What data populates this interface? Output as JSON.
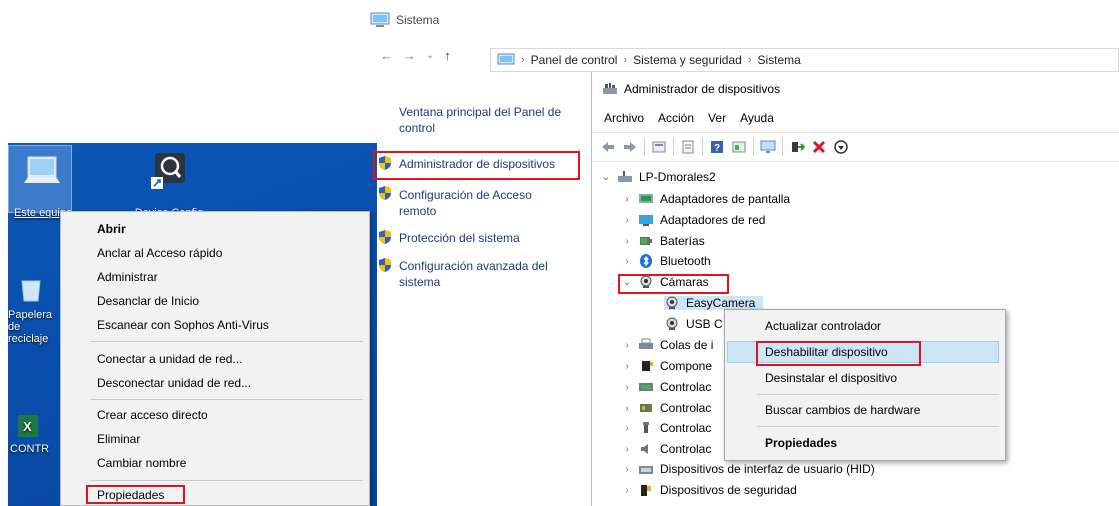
{
  "sistema_window": {
    "title": "Sistema",
    "breadcrumb": [
      "Panel de control",
      "Sistema y seguridad",
      "Sistema"
    ],
    "left_pane": {
      "home_link": "Ventana principal del Panel de control",
      "links": [
        "Administrador de dispositivos",
        "Configuración de Acceso remoto",
        "Protección del sistema",
        "Configuración avanzada del sistema"
      ]
    }
  },
  "desktop": {
    "icons": [
      "Este equipo",
      "Device Config",
      "Papelera de reciclaje",
      "CONTR"
    ],
    "context_menu": {
      "items": [
        "Abrir",
        "Anclar al Acceso rápido",
        "Administrar",
        "Desanclar de Inicio",
        "Escanear con Sophos Anti-Virus",
        "Conectar a unidad de red...",
        "Desconectar unidad de red...",
        "Crear acceso directo",
        "Eliminar",
        "Cambiar nombre",
        "Propiedades"
      ]
    }
  },
  "device_manager": {
    "title": "Administrador de dispositivos",
    "menu": [
      "Archivo",
      "Acción",
      "Ver",
      "Ayuda"
    ],
    "tree": {
      "root": "LP-Dmorales2",
      "categories": [
        "Adaptadores de pantalla",
        "Adaptadores de red",
        "Baterías",
        "Bluetooth",
        "Cámaras",
        "Colas de i",
        "Compone",
        "Controlac",
        "Controlac",
        "Controlac",
        "Controlac",
        "Dispositivos de interfaz de usuario (HID)",
        "Dispositivos de seguridad"
      ],
      "camera_children": [
        "EasyCamera",
        "USB C"
      ]
    },
    "context_menu": {
      "items": [
        "Actualizar controlador",
        "Deshabilitar dispositivo",
        "Desinstalar el dispositivo",
        "Buscar cambios de hardware",
        "Propiedades"
      ]
    }
  },
  "colors": {
    "highlight_red": "#e0141e",
    "menu_hover": "#cde6f7",
    "desktop_blue": "#0a4fae"
  }
}
